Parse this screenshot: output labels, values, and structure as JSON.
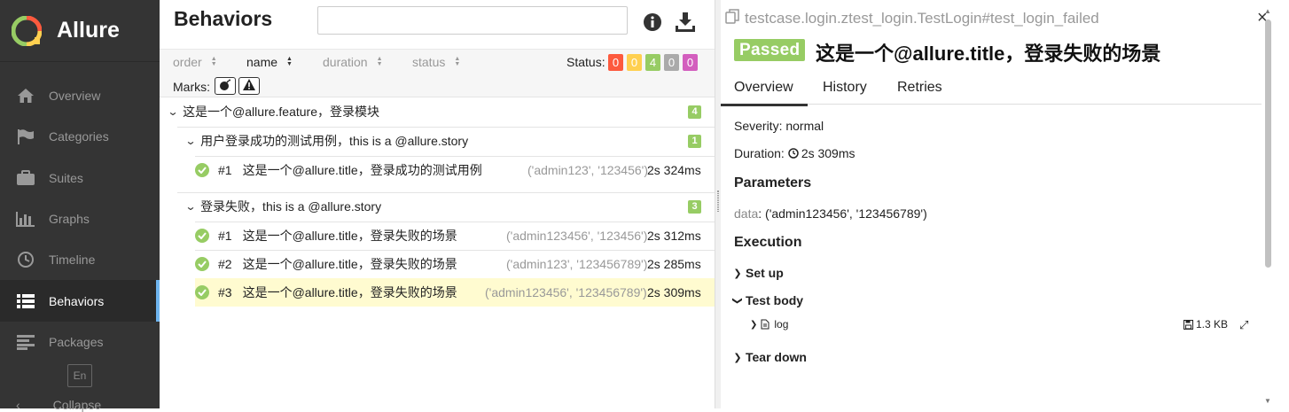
{
  "brand": {
    "name": "Allure"
  },
  "sidebar": {
    "items": [
      {
        "label": "Overview",
        "icon": "home-icon"
      },
      {
        "label": "Categories",
        "icon": "flag-icon"
      },
      {
        "label": "Suites",
        "icon": "briefcase-icon"
      },
      {
        "label": "Graphs",
        "icon": "bar-chart-icon"
      },
      {
        "label": "Timeline",
        "icon": "clock-icon"
      },
      {
        "label": "Behaviors",
        "icon": "list-icon",
        "active": true
      },
      {
        "label": "Packages",
        "icon": "align-left-icon"
      }
    ],
    "language": "En",
    "collapse_label": "Collapse"
  },
  "tree": {
    "title": "Behaviors",
    "search": {
      "value": "",
      "placeholder": ""
    },
    "sorters": [
      "order",
      "name",
      "duration",
      "status"
    ],
    "active_sorter": "name",
    "status_label": "Status:",
    "status_counts": [
      {
        "value": "0",
        "color": "#fd5a3e"
      },
      {
        "value": "0",
        "color": "#ffd050"
      },
      {
        "value": "4",
        "color": "#97cc64"
      },
      {
        "value": "0",
        "color": "#aaaaaa"
      },
      {
        "value": "0",
        "color": "#d35ebe"
      }
    ],
    "marks_label": "Marks:",
    "feature": {
      "label": "这是一个@allure.feature，登录模块",
      "count": "4"
    },
    "story1": {
      "label": "用户登录成功的测试用例，this is a @allure.story",
      "count": "1"
    },
    "story2": {
      "label": "登录失败，this is a @allure.story",
      "count": "3"
    },
    "cases": [
      {
        "num": "#1",
        "title": "这是一个@allure.title，登录成功的测试用例",
        "params": "('admin123', '123456')",
        "duration": "2s 324ms"
      },
      {
        "num": "#1",
        "title": "这是一个@allure.title，登录失败的场景",
        "params": "('admin123456', '123456')",
        "duration": "2s 312ms"
      },
      {
        "num": "#2",
        "title": "这是一个@allure.title，登录失败的场景",
        "params": "('admin123', '123456789')",
        "duration": "2s 285ms"
      },
      {
        "num": "#3",
        "title": "这是一个@allure.title，登录失败的场景",
        "params": "('admin123456', '123456789')",
        "duration": "2s 309ms"
      }
    ]
  },
  "detail": {
    "fullname": "testcase.login.ztest_login.TestLogin#test_login_failed",
    "status": "Passed",
    "title": "这是一个@allure.title，登录失败的场景",
    "tabs": [
      "Overview",
      "History",
      "Retries"
    ],
    "severity": "Severity: normal",
    "duration_label": "Duration:",
    "duration_value": "2s 309ms",
    "parameters_heading": "Parameters",
    "param_key": "data",
    "param_value": ": ('admin123456', '123456789')",
    "execution_heading": "Execution",
    "steps": {
      "setup": "Set up",
      "body": "Test body",
      "teardown": "Tear down"
    },
    "attachment": {
      "name": "log",
      "size": "1.3 KB"
    }
  }
}
